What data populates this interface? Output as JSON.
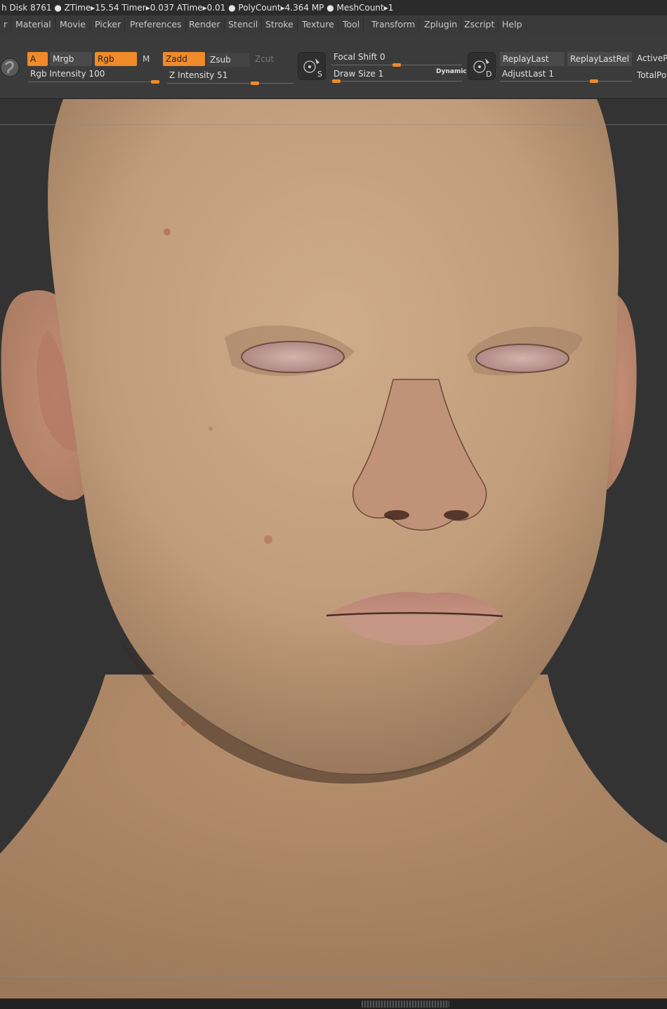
{
  "status": {
    "text": "h Disk 8761 ●  ZTime▸15.54 Timer▸0.037 ATime▸0.01 ● PolyCount▸4.364 MP  ● MeshCount▸1"
  },
  "menu": [
    "r",
    "Material",
    "Movie",
    "Picker",
    "Preferences",
    "Render",
    "Stencil",
    "Stroke",
    "Texture",
    "Tool",
    "Transform",
    "Zplugin",
    "Zscript",
    "Help"
  ],
  "toolbar": {
    "a_label": "A",
    "mrgb_label": "Mrgb",
    "rgb_label": "Rgb",
    "m_label": "M",
    "zadd_label": "Zadd",
    "zsub_label": "Zsub",
    "zcut_label": "Zcut",
    "rgb_intensity_label": "Rgb Intensity 100",
    "rgb_intensity_value": 100,
    "z_intensity_label": "Z Intensity 51",
    "z_intensity_value": 51,
    "focal_shift_label": "Focal Shift 0",
    "focal_shift_value": 0,
    "draw_size_label": "Draw Size 1",
    "draw_size_value": 1,
    "dynamic_label": "Dynamic",
    "s_icon_letter": "S",
    "d_icon_letter": "D",
    "replaylast_label": "ReplayLast",
    "replaylastrel_label": "ReplayLastRel",
    "adjustlast_label": "AdjustLast 1",
    "activepoints_label": "ActivePo",
    "totalpoints_label": "TotalPo"
  },
  "colors": {
    "accent": "#f08a2a",
    "skin": "#c9a584",
    "background": "#333333"
  }
}
